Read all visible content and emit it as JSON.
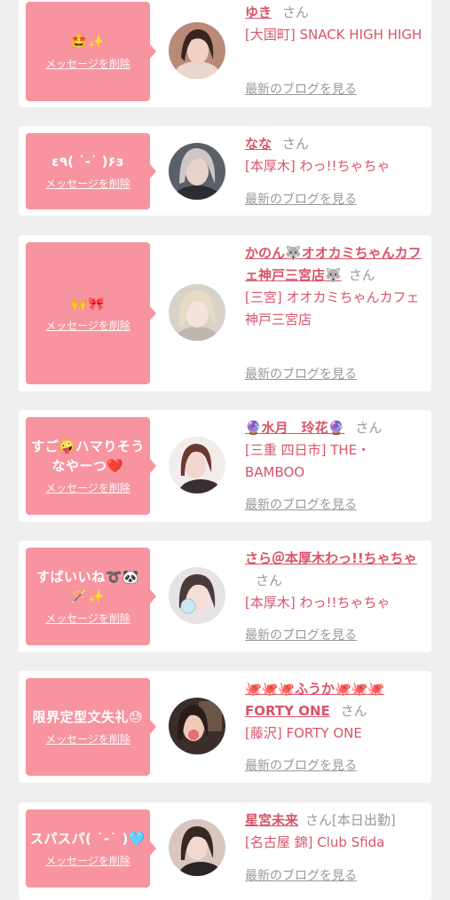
{
  "delete_label": "メッセージを削除",
  "blog_label": "最新のブログを見る",
  "san": "さん",
  "colors": {
    "bubble": "#f7949f",
    "name": "#d9546a",
    "muted": "#999999",
    "background": "#efefef"
  },
  "cards": [
    {
      "message": "🤩✨",
      "name": "ゆき",
      "suffix": "",
      "shop": "[大国町] SNACK HIGH HIGH"
    },
    {
      "message": "ε٩( ˙-˙ )۶з",
      "name": "なな",
      "suffix": "",
      "shop": "[本厚木] わっ!!ちゃちゃ"
    },
    {
      "message": "🙌🎀",
      "name": "かのん🐺オオカミちゃんカフェ神戸三宮店🐺",
      "suffix": "",
      "shop": "[三宮] オオカミちゃんカフェ神戸三宮店"
    },
    {
      "message": "すご🤪ハマりそうなやーつ❤️",
      "name": "🔮水月　玲花🔮",
      "suffix": "",
      "shop": "[三重 四日市] THE・BAMBOO"
    },
    {
      "message": "すばいいね➰🐼🪄✨",
      "name": "さら＠本厚木わっ!!ちゃちゃ",
      "suffix": "",
      "shop": "[本厚木] わっ!!ちゃちゃ"
    },
    {
      "message": "限界定型文失礼😓",
      "name": "🐙🐙🐙ふうか🐙🐙🐙FORTY ONE",
      "suffix": "",
      "shop": "[藤沢] FORTY ONE"
    },
    {
      "message": "スパスパ( ˙-˙ )🩵",
      "name": "星宮未来",
      "suffix": "[本日出勤]",
      "shop": "[名古屋 錦] Club Sfida"
    }
  ]
}
